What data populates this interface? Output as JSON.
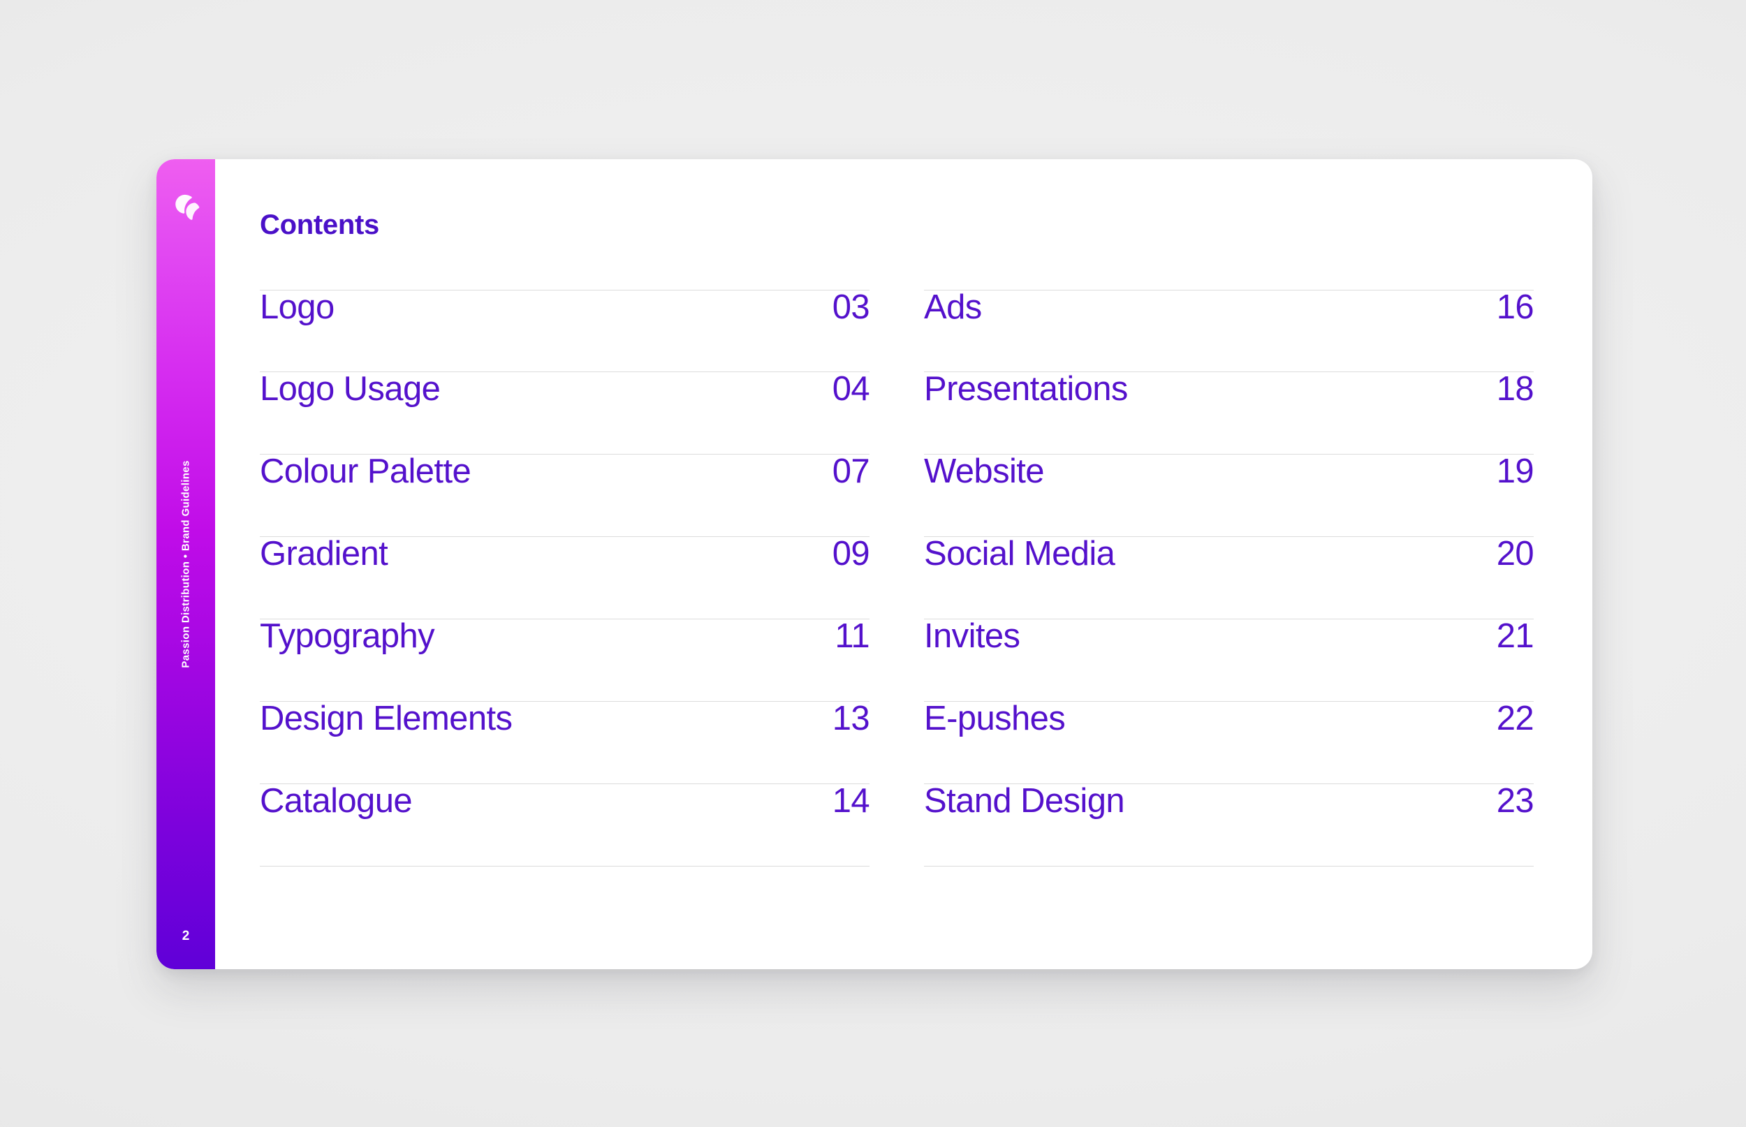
{
  "theme": {
    "background": "#ececec",
    "card_background": "#ffffff",
    "accent_purple": "#5411cc",
    "heading_purple": "#4a10c8",
    "rail_gradient_top": "#ef5ef0",
    "rail_gradient_mid": "#c00ce8",
    "rail_gradient_bottom": "#6000d8",
    "divider": "#dcdcdc"
  },
  "rail": {
    "logo_icon": "passion-distribution-logo-icon",
    "vertical_label": "Passion Distribution  •  Brand Guidelines",
    "page_number": "2"
  },
  "slide": {
    "heading": "Contents"
  },
  "contents": {
    "left_column": [
      {
        "title": "Logo",
        "page": "03"
      },
      {
        "title": "Logo Usage",
        "page": "04"
      },
      {
        "title": "Colour Palette",
        "page": "07"
      },
      {
        "title": "Gradient",
        "page": "09"
      },
      {
        "title": "Typography",
        "page": "11"
      },
      {
        "title": "Design Elements",
        "page": "13"
      },
      {
        "title": "Catalogue",
        "page": "14"
      }
    ],
    "right_column": [
      {
        "title": "Ads",
        "page": "16"
      },
      {
        "title": "Presentations",
        "page": "18"
      },
      {
        "title": "Website",
        "page": "19"
      },
      {
        "title": "Social Media",
        "page": "20"
      },
      {
        "title": "Invites",
        "page": "21"
      },
      {
        "title": "E-pushes",
        "page": "22"
      },
      {
        "title": "Stand Design",
        "page": "23"
      }
    ]
  }
}
